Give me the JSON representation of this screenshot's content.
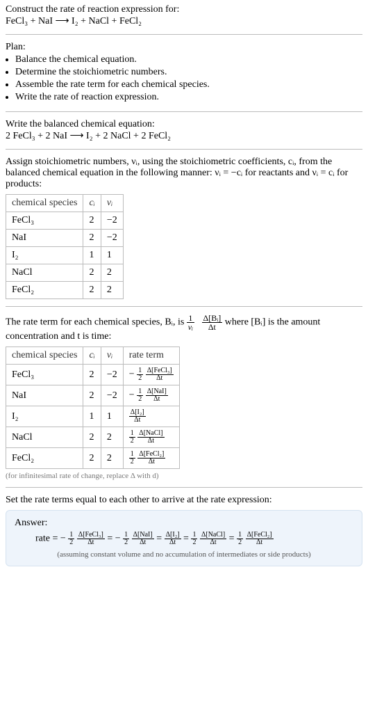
{
  "intro": {
    "line1": "Construct the rate of reaction expression for:",
    "eq": "FeCl₃ + NaI ⟶ I₂ + NaCl + FeCl₂"
  },
  "plan": {
    "heading": "Plan:",
    "items": [
      "Balance the chemical equation.",
      "Determine the stoichiometric numbers.",
      "Assemble the rate term for each chemical species.",
      "Write the rate of reaction expression."
    ]
  },
  "balanced": {
    "heading": "Write the balanced chemical equation:",
    "eq": "2 FeCl₃ + 2 NaI ⟶ I₂ + 2 NaCl + 2 FeCl₂"
  },
  "stoich": {
    "text_a": "Assign stoichiometric numbers, νᵢ, using the stoichiometric coefficients, cᵢ, from the balanced chemical equation in the following manner: νᵢ = −cᵢ for reactants and νᵢ = cᵢ for products:",
    "headers": [
      "chemical species",
      "cᵢ",
      "νᵢ"
    ],
    "rows": [
      {
        "species": "FeCl₃",
        "c": "2",
        "nu": "−2"
      },
      {
        "species": "NaI",
        "c": "2",
        "nu": "−2"
      },
      {
        "species": "I₂",
        "c": "1",
        "nu": "1"
      },
      {
        "species": "NaCl",
        "c": "2",
        "nu": "2"
      },
      {
        "species": "FeCl₂",
        "c": "2",
        "nu": "2"
      }
    ]
  },
  "rateterm": {
    "text_a": "The rate term for each chemical species, Bᵢ, is ",
    "text_b": " where [Bᵢ] is the amount concentration and t is time:",
    "headers": [
      "chemical species",
      "cᵢ",
      "νᵢ",
      "rate term"
    ],
    "rows": [
      {
        "species": "FeCl₃",
        "c": "2",
        "nu": "−2",
        "sign": "−",
        "coef_num": "1",
        "coef_den": "2",
        "delta": "Δ[FeCl₃]"
      },
      {
        "species": "NaI",
        "c": "2",
        "nu": "−2",
        "sign": "−",
        "coef_num": "1",
        "coef_den": "2",
        "delta": "Δ[NaI]"
      },
      {
        "species": "I₂",
        "c": "1",
        "nu": "1",
        "sign": "",
        "coef_num": "",
        "coef_den": "",
        "delta": "Δ[I₂]"
      },
      {
        "species": "NaCl",
        "c": "2",
        "nu": "2",
        "sign": "",
        "coef_num": "1",
        "coef_den": "2",
        "delta": "Δ[NaCl]"
      },
      {
        "species": "FeCl₂",
        "c": "2",
        "nu": "2",
        "sign": "",
        "coef_num": "1",
        "coef_den": "2",
        "delta": "Δ[FeCl₂]"
      }
    ],
    "footnote": "(for infinitesimal rate of change, replace Δ with d)"
  },
  "final": {
    "lead": "Set the rate terms equal to each other to arrive at the rate expression:",
    "answer_label": "Answer:",
    "rate_label": "rate = ",
    "terms": [
      {
        "sign": "−",
        "coef_num": "1",
        "coef_den": "2",
        "delta": "Δ[FeCl₃]"
      },
      {
        "sign": "−",
        "coef_num": "1",
        "coef_den": "2",
        "delta": "Δ[NaI]"
      },
      {
        "sign": "",
        "coef_num": "",
        "coef_den": "",
        "delta": "Δ[I₂]"
      },
      {
        "sign": "",
        "coef_num": "1",
        "coef_den": "2",
        "delta": "Δ[NaCl]"
      },
      {
        "sign": "",
        "coef_num": "1",
        "coef_den": "2",
        "delta": "Δ[FeCl₂]"
      }
    ],
    "assumption": "(assuming constant volume and no accumulation of intermediates or side products)"
  },
  "dt": "Δt",
  "inline": {
    "frac1_num": "1",
    "frac1_den": "νᵢ",
    "frac2_num": "Δ[Bᵢ]",
    "frac2_den": "Δt"
  }
}
